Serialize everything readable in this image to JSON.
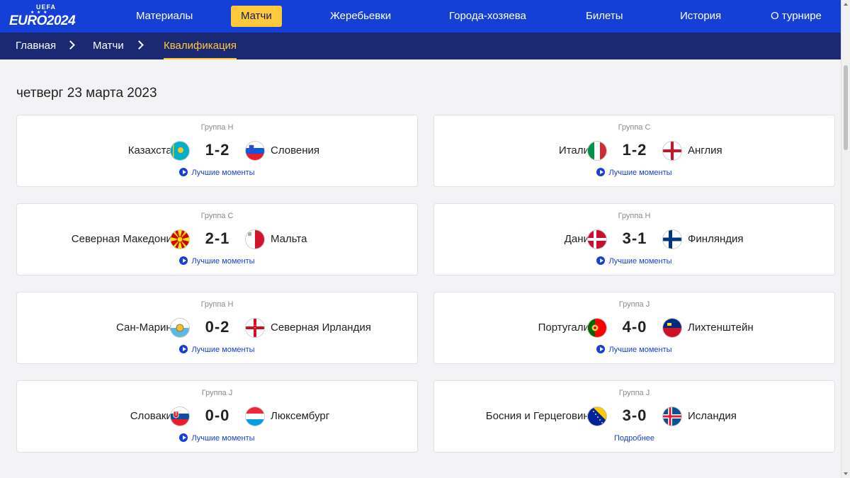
{
  "logo": {
    "top": "UEFA",
    "main": "EURO2024"
  },
  "nav": [
    "Материалы",
    "Матчи",
    "Жеребьевки",
    "Города-хозяева",
    "Билеты",
    "История",
    "О турнире"
  ],
  "breadcrumb": [
    "Главная",
    "Матчи",
    "Квалификация"
  ],
  "date": "четверг 23 марта 2023",
  "matches": [
    {
      "group": "Группа H",
      "home": "Казахстан",
      "score": "1-2",
      "away": "Словения",
      "link": "Лучшие моменты",
      "home_flag": "kazakhstan-flag",
      "away_flag": "slovenia-flag"
    },
    {
      "group": "Группа C",
      "home": "Италия",
      "score": "1-2",
      "away": "Англия",
      "link": "Лучшие моменты",
      "home_flag": "italy-flag",
      "away_flag": "england-flag"
    },
    {
      "group": "Группа C",
      "home": "Северная Македония",
      "score": "2-1",
      "away": "Мальта",
      "link": "Лучшие моменты",
      "home_flag": "north-macedonia-flag",
      "away_flag": "malta-flag"
    },
    {
      "group": "Группа H",
      "home": "Дания",
      "score": "3-1",
      "away": "Финляндия",
      "link": "Лучшие моменты",
      "home_flag": "denmark-flag",
      "away_flag": "finland-flag"
    },
    {
      "group": "Группа H",
      "home": "Сан-Марино",
      "score": "0-2",
      "away": "Северная Ирландия",
      "link": "Лучшие моменты",
      "home_flag": "san-marino-flag",
      "away_flag": "northern-ireland-flag"
    },
    {
      "group": "Группа J",
      "home": "Португалия",
      "score": "4-0",
      "away": "Лихтенштейн",
      "link": "Лучшие моменты",
      "home_flag": "portugal-flag",
      "away_flag": "liechtenstein-flag"
    },
    {
      "group": "Группа J",
      "home": "Словакия",
      "score": "0-0",
      "away": "Люксембург",
      "link": "Лучшие моменты",
      "home_flag": "slovakia-flag",
      "away_flag": "luxembourg-flag"
    },
    {
      "group": "Группа J",
      "home": "Босния и Герцеговина",
      "score": "3-0",
      "away": "Исландия",
      "link": "Подробнее",
      "home_flag": "bosnia-flag",
      "away_flag": "iceland-flag"
    }
  ],
  "colors": {
    "brand_blue": "#1440d8",
    "breadcrumb_bg": "#1b2872",
    "accent_yellow": "#ffc93c"
  }
}
